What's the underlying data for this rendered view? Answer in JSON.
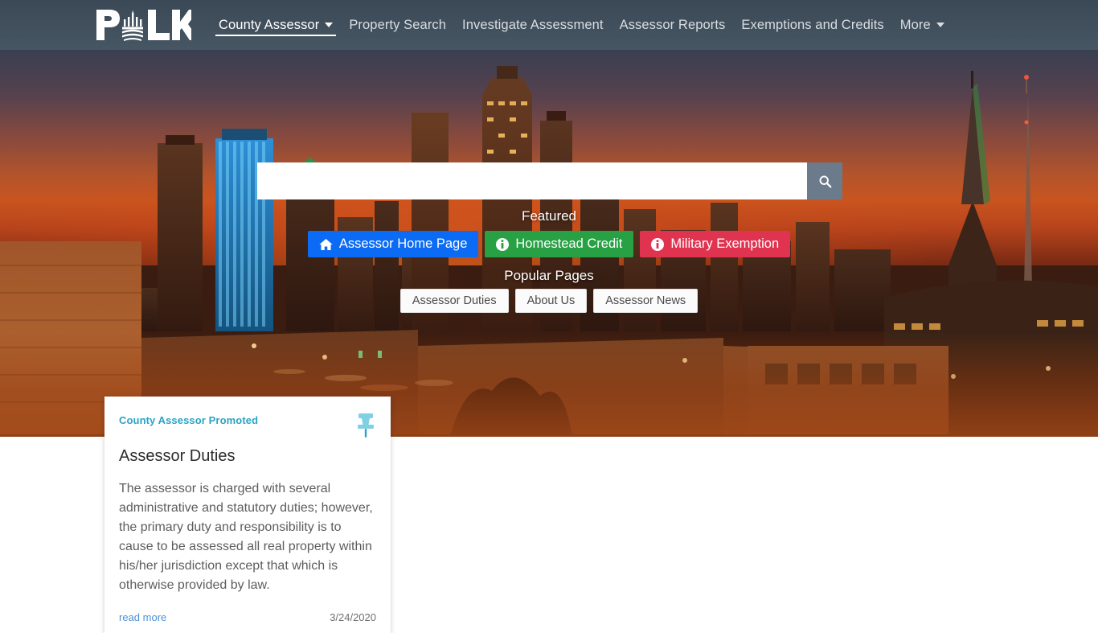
{
  "brand": {
    "name": "POLK",
    "logo_icon": "polk-capitol-dome-logo"
  },
  "nav": {
    "items": [
      {
        "label": "County Assessor",
        "active": true,
        "has_caret": true
      },
      {
        "label": "Property Search",
        "active": false,
        "has_caret": false
      },
      {
        "label": "Investigate Assessment",
        "active": false,
        "has_caret": false
      },
      {
        "label": "Assessor Reports",
        "active": false,
        "has_caret": false
      },
      {
        "label": "Exemptions and Credits",
        "active": false,
        "has_caret": false
      },
      {
        "label": "More",
        "active": false,
        "has_caret": true
      }
    ]
  },
  "search": {
    "value": "",
    "placeholder": "",
    "button_icon": "search-icon",
    "button_color": "#6c7b8b"
  },
  "featured": {
    "label": "Featured",
    "buttons": [
      {
        "label": "Assessor Home Page",
        "icon": "home-icon",
        "color": "#0b6bf5"
      },
      {
        "label": "Homestead Credit",
        "icon": "info-circle-icon",
        "color": "#28a144"
      },
      {
        "label": "Military Exemption",
        "icon": "info-circle-icon",
        "color": "#e0334f"
      }
    ]
  },
  "popular": {
    "label": "Popular Pages",
    "buttons": [
      {
        "label": "Assessor Duties"
      },
      {
        "label": "About Us"
      },
      {
        "label": "Assessor News"
      }
    ]
  },
  "card": {
    "kicker": "County Assessor Promoted",
    "title": "Assessor Duties",
    "body": "The assessor is charged with several administrative and statutory duties; however, the primary duty and responsibility is to cause to be assessed all real property within his/her jurisdiction except that which is otherwise provided by law.",
    "read_more": "read more",
    "date": "3/24/2020",
    "pin_icon": "pushpin-icon",
    "kicker_color": "#2ba3c4",
    "pin_color": "#7fd0e3"
  }
}
